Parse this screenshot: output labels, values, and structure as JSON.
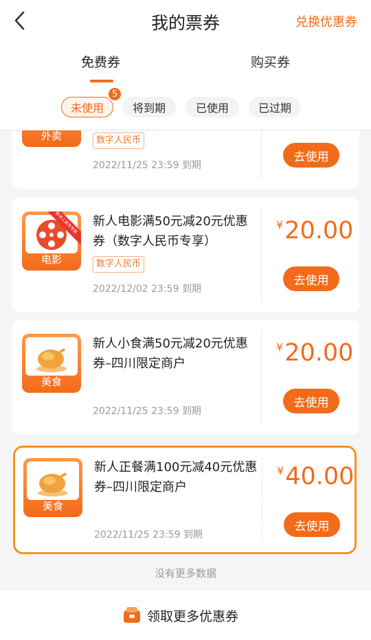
{
  "header": {
    "title": "我的票券",
    "exchange_label": "兑换优惠券"
  },
  "tabs": [
    {
      "label": "免费券",
      "active": true
    },
    {
      "label": "购买券",
      "active": false
    }
  ],
  "filters": [
    {
      "label": "未使用",
      "active": true,
      "badge": "5"
    },
    {
      "label": "将到期",
      "active": false
    },
    {
      "label": "已使用",
      "active": false
    },
    {
      "label": "已过期",
      "active": false
    }
  ],
  "coupons": [
    {
      "category": "外卖",
      "tag": "数字人民币",
      "expire": "2022/11/25 23:59 到期",
      "button": "去使用"
    },
    {
      "category": "电影",
      "ribbon": "数字人民币专属",
      "title": "新人电影满50元减20元优惠券（数字人民币专享）",
      "tag": "数字人民币",
      "currency": "¥",
      "amount": "20.00",
      "expire": "2022/12/02 23:59 到期",
      "button": "去使用"
    },
    {
      "category": "美食",
      "title": "新人小食满50元减20元优惠券–四川限定商户",
      "currency": "¥",
      "amount": "20.00",
      "expire": "2022/11/25 23:59 到期",
      "button": "去使用"
    },
    {
      "category": "美食",
      "title": "新人正餐满100元减40元优惠券–四川限定商户",
      "currency": "¥",
      "amount": "40.00",
      "expire": "2022/11/25 23:59 到期",
      "button": "去使用",
      "highlighted": true
    }
  ],
  "list_footer": "没有更多数据",
  "bottom_bar": {
    "label": "领取更多优惠券"
  },
  "colors": {
    "accent": "#f26b1a",
    "highlight_border": "#f7931e",
    "ribbon": "#e8352b"
  },
  "icons": {
    "back": "chevron-left-icon",
    "movie": "film-reel-icon",
    "food": "roast-chicken-icon",
    "bottom": "coupon-bag-icon"
  }
}
